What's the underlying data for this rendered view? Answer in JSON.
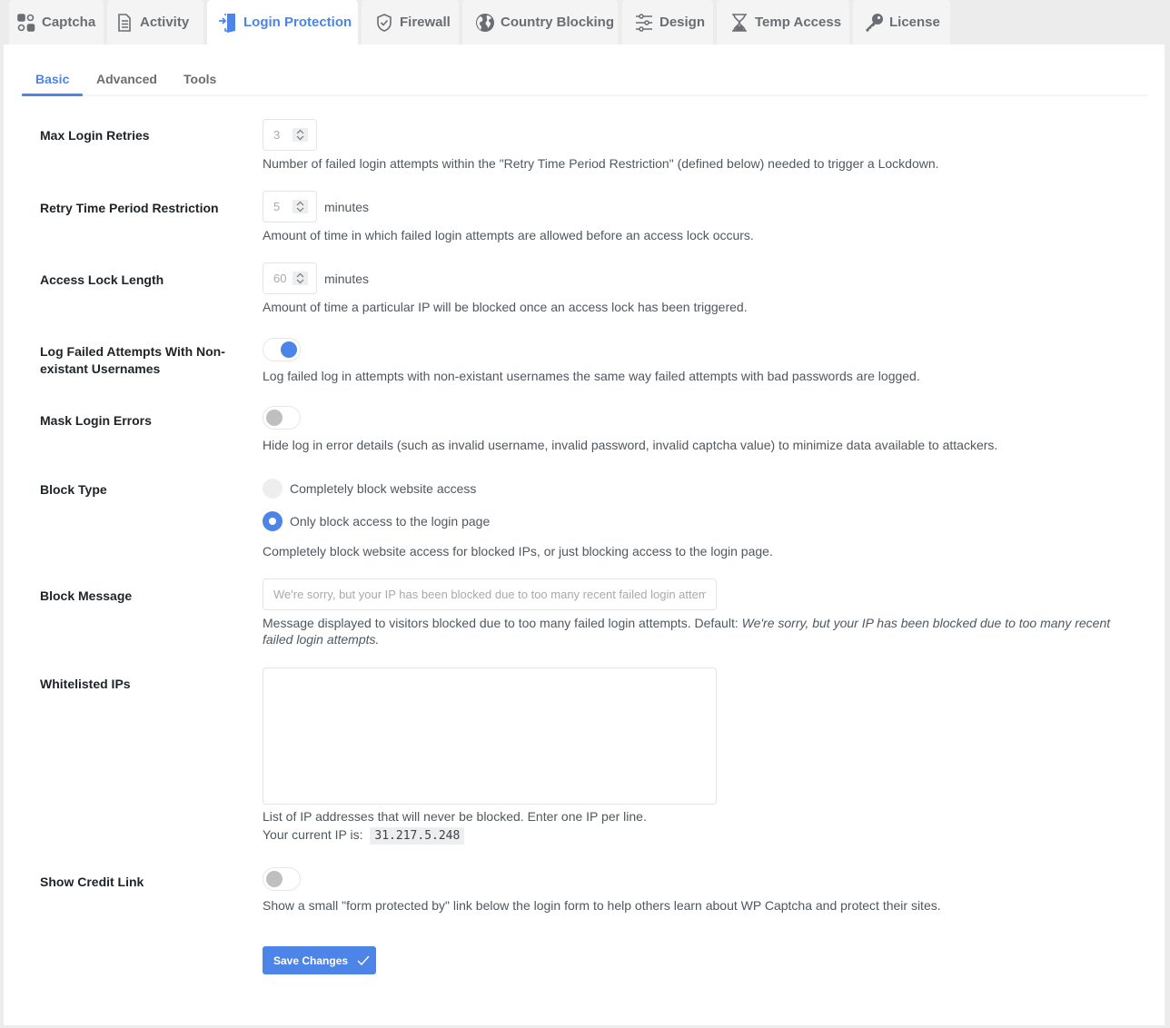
{
  "tabs": [
    {
      "label": "Captcha",
      "icon": "captcha-icon",
      "active": false
    },
    {
      "label": "Activity",
      "icon": "document-icon",
      "active": false
    },
    {
      "label": "Login Protection",
      "icon": "login-door-icon",
      "active": true
    },
    {
      "label": "Firewall",
      "icon": "shield-check-icon",
      "active": false
    },
    {
      "label": "Country Blocking",
      "icon": "globe-icon",
      "active": false
    },
    {
      "label": "Design",
      "icon": "sliders-icon",
      "active": false
    },
    {
      "label": "Temp Access",
      "icon": "hourglass-icon",
      "active": false
    },
    {
      "label": "License",
      "icon": "key-icon",
      "active": false
    }
  ],
  "subtabs": [
    {
      "label": "Basic",
      "active": true
    },
    {
      "label": "Advanced",
      "active": false
    },
    {
      "label": "Tools",
      "active": false
    }
  ],
  "settings": {
    "max_login_retries": {
      "label": "Max Login Retries",
      "value": "3",
      "description": "Number of failed login attempts within the \"Retry Time Period Restriction\" (defined below) needed to trigger a Lockdown."
    },
    "retry_time_period": {
      "label": "Retry Time Period Restriction",
      "value": "5",
      "unit": "minutes",
      "description": "Amount of time in which failed login attempts are allowed before an access lock occurs."
    },
    "access_lock_length": {
      "label": "Access Lock Length",
      "value": "60",
      "unit": "minutes",
      "description": "Amount of time a particular IP will be blocked once an access lock has been triggered."
    },
    "log_nonexistent": {
      "label": "Log Failed Attempts With Non-existant Usernames",
      "enabled": true,
      "description": "Log failed log in attempts with non-existant usernames the same way failed attempts with bad passwords are logged."
    },
    "mask_login_errors": {
      "label": "Mask Login Errors",
      "enabled": false,
      "description": "Hide log in error details (such as invalid username, invalid password, invalid captcha value) to minimize data available to attackers."
    },
    "block_type": {
      "label": "Block Type",
      "options": [
        {
          "label": "Completely block website access",
          "checked": false
        },
        {
          "label": "Only block access to the login page",
          "checked": true
        }
      ],
      "description": "Completely block website access for blocked IPs, or just blocking access to the login page."
    },
    "block_message": {
      "label": "Block Message",
      "value": "",
      "placeholder": "We're sorry, but your IP has been blocked due to too many recent failed login attempts.",
      "description_prefix": "Message displayed to visitors blocked due to too many failed login attempts. Default: ",
      "description_default": "We're sorry, but your IP has been blocked due to too many recent failed login attempts."
    },
    "whitelisted_ips": {
      "label": "Whitelisted IPs",
      "value": "",
      "description": "List of IP addresses that will never be blocked. Enter one IP per line.",
      "current_ip_label": "Your current IP is:",
      "current_ip": "31.217.5.248"
    },
    "show_credit_link": {
      "label": "Show Credit Link",
      "enabled": false,
      "description": "Show a small \"form protected by\" link below the login form to help others learn about WP Captcha and protect their sites."
    }
  },
  "save_button": {
    "label": "Save Changes",
    "icon": "check-icon"
  },
  "colors": {
    "accent": "#4d84e8",
    "toggle_off": "#bfbfbf",
    "tab_bg": "#f4f4f4"
  }
}
